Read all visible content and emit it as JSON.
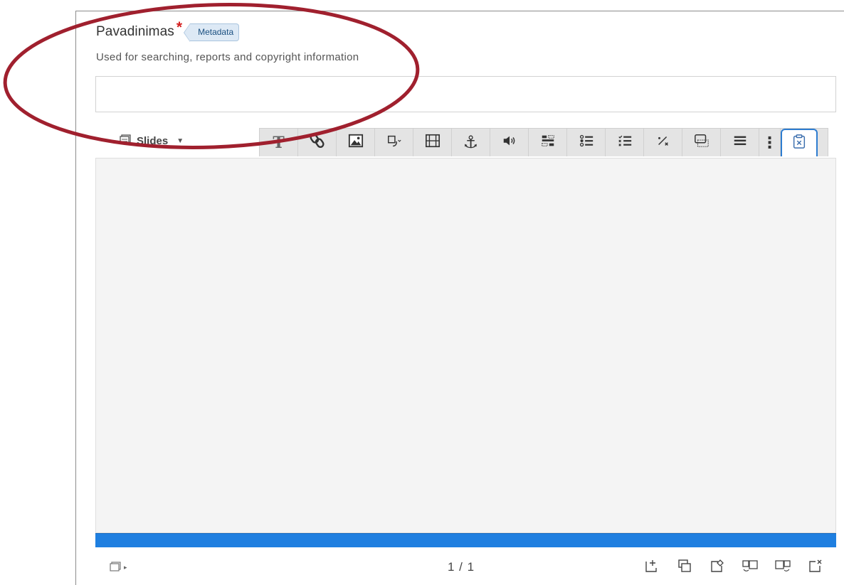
{
  "field": {
    "label": "Pavadinimas",
    "required_mark": "*",
    "badge": "Metadata",
    "description": "Used for searching, reports and copyright information",
    "input_value": "",
    "input_placeholder": ""
  },
  "slides_menu": {
    "label": "Slides",
    "icon": "slides-icon"
  },
  "toolbar": {
    "tools": [
      {
        "icon": "text-icon",
        "glyph": "T"
      },
      {
        "icon": "link-icon"
      },
      {
        "icon": "image-icon"
      },
      {
        "icon": "shapes-icon"
      },
      {
        "icon": "video-icon"
      },
      {
        "icon": "anchor-icon",
        "glyph": "⚓"
      },
      {
        "icon": "audio-icon"
      },
      {
        "icon": "drag-text-icon"
      },
      {
        "icon": "single-choice-icon"
      },
      {
        "icon": "multi-choice-icon"
      },
      {
        "icon": "fill-blanks-icon"
      },
      {
        "icon": "summary-icon"
      },
      {
        "icon": "list-icon"
      },
      {
        "icon": "more-icon",
        "glyph": "⋮"
      },
      {
        "icon": "paste-icon"
      }
    ],
    "active_tool": "paste-icon"
  },
  "colors": {
    "progress_bar": "#1f7fe0",
    "canvas_bg": "#f4f4f4",
    "toolbar_bg": "#e4e4e4",
    "required_red": "#d42020",
    "annotation_red": "#a0202e",
    "active_tool_border": "#2d7cd0"
  },
  "footer": {
    "pager": "1 / 1",
    "tools": [
      {
        "icon": "add-slide-icon"
      },
      {
        "icon": "clone-slide-icon"
      },
      {
        "icon": "slide-background-icon"
      },
      {
        "icon": "move-slide-left-icon"
      },
      {
        "icon": "move-slide-right-icon"
      },
      {
        "icon": "delete-slide-icon"
      }
    ]
  }
}
